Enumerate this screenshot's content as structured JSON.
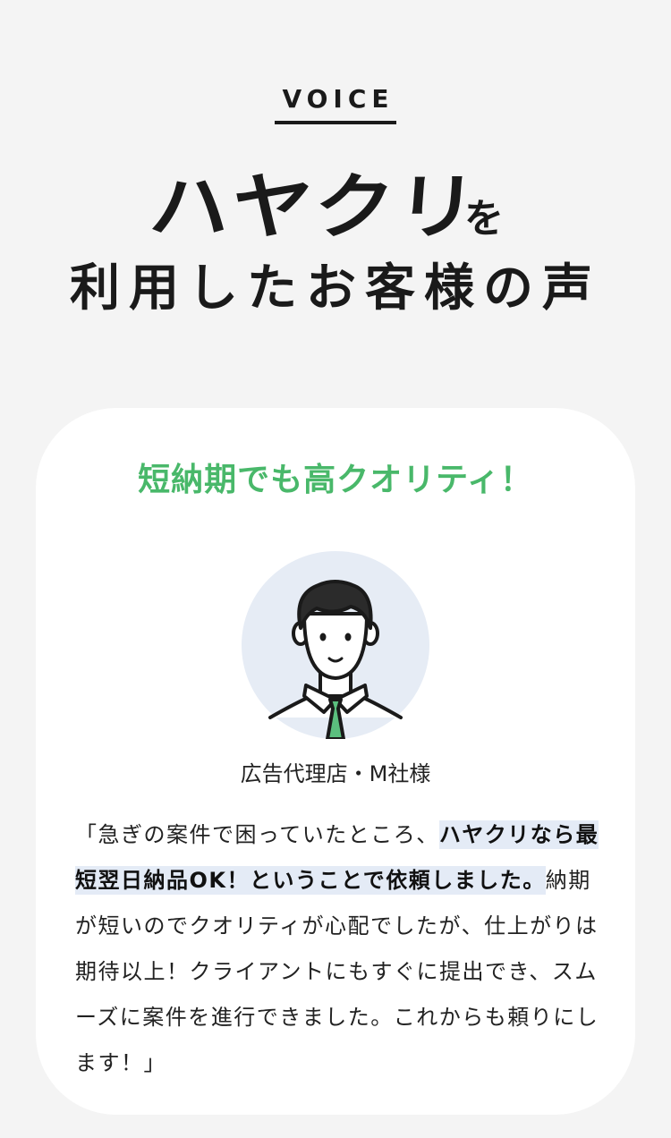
{
  "section": {
    "label": "VOICE"
  },
  "headline": {
    "brand": "ハヤクリ",
    "particle": "を",
    "line2": "利用したお客様の声"
  },
  "card": {
    "title": "短納期でも高クオリティ！",
    "customer": "広告代理店・M社様",
    "avatar_icon": "businessman-avatar-icon",
    "quote": {
      "open": "「急ぎの案件で困っていたところ、",
      "highlight": "ハヤクリなら最短翌日納品OK！ということで依頼しました。",
      "rest": "納期が短いのでクオリティが心配でしたが、仕上がりは期待以上！クライアントにもすぐに提出でき、スムーズに案件を進行できました。これからも頼りにします！」"
    }
  },
  "colors": {
    "background": "#f4f4f4",
    "card": "#ffffff",
    "accent_green": "#49b86a",
    "highlight": "#e4ebf6",
    "avatar_circle": "#e6ecf5"
  }
}
